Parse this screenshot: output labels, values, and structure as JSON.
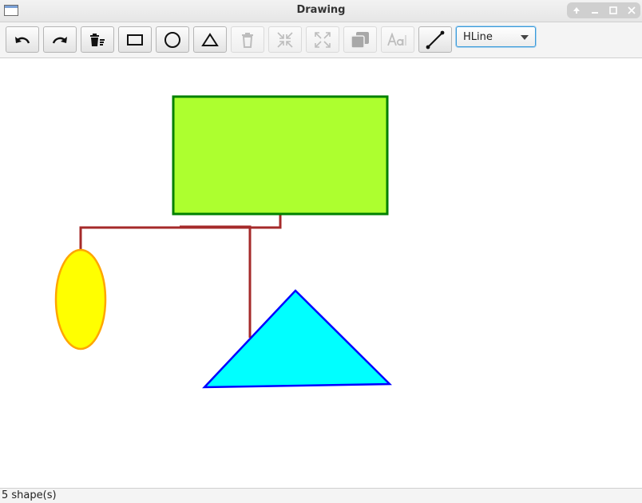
{
  "window": {
    "title": "Drawing"
  },
  "toolbar": {
    "buttons": [
      {
        "name": "undo",
        "icon": "undo-icon",
        "enabled": true
      },
      {
        "name": "redo",
        "icon": "redo-icon",
        "enabled": true
      },
      {
        "name": "clear-all",
        "icon": "trash-list-icon",
        "enabled": true
      },
      {
        "name": "rectangle",
        "icon": "rectangle-icon",
        "enabled": true
      },
      {
        "name": "circle",
        "icon": "circle-icon",
        "enabled": true
      },
      {
        "name": "triangle",
        "icon": "triangle-icon",
        "enabled": true
      },
      {
        "name": "delete",
        "icon": "trash-icon",
        "enabled": false
      },
      {
        "name": "shrink",
        "icon": "shrink-icon",
        "enabled": false
      },
      {
        "name": "expand",
        "icon": "expand-icon",
        "enabled": false
      },
      {
        "name": "layers",
        "icon": "layers-icon",
        "enabled": false
      },
      {
        "name": "text",
        "icon": "text-icon",
        "enabled": false
      },
      {
        "name": "connector",
        "icon": "line-icon",
        "enabled": true
      }
    ],
    "line_type": {
      "selected": "HLine"
    }
  },
  "shapes": [
    {
      "type": "rectangle",
      "fill": "#adff2f",
      "stroke": "#008000"
    },
    {
      "type": "ellipse",
      "fill": "#ffff00",
      "stroke": "#ffa500"
    },
    {
      "type": "triangle",
      "fill": "#00ffff",
      "stroke": "#0000ff"
    },
    {
      "type": "connector",
      "stroke": "#a52a2a"
    },
    {
      "type": "connector",
      "stroke": "#a52a2a"
    }
  ],
  "status": {
    "text": "5 shape(s)"
  }
}
